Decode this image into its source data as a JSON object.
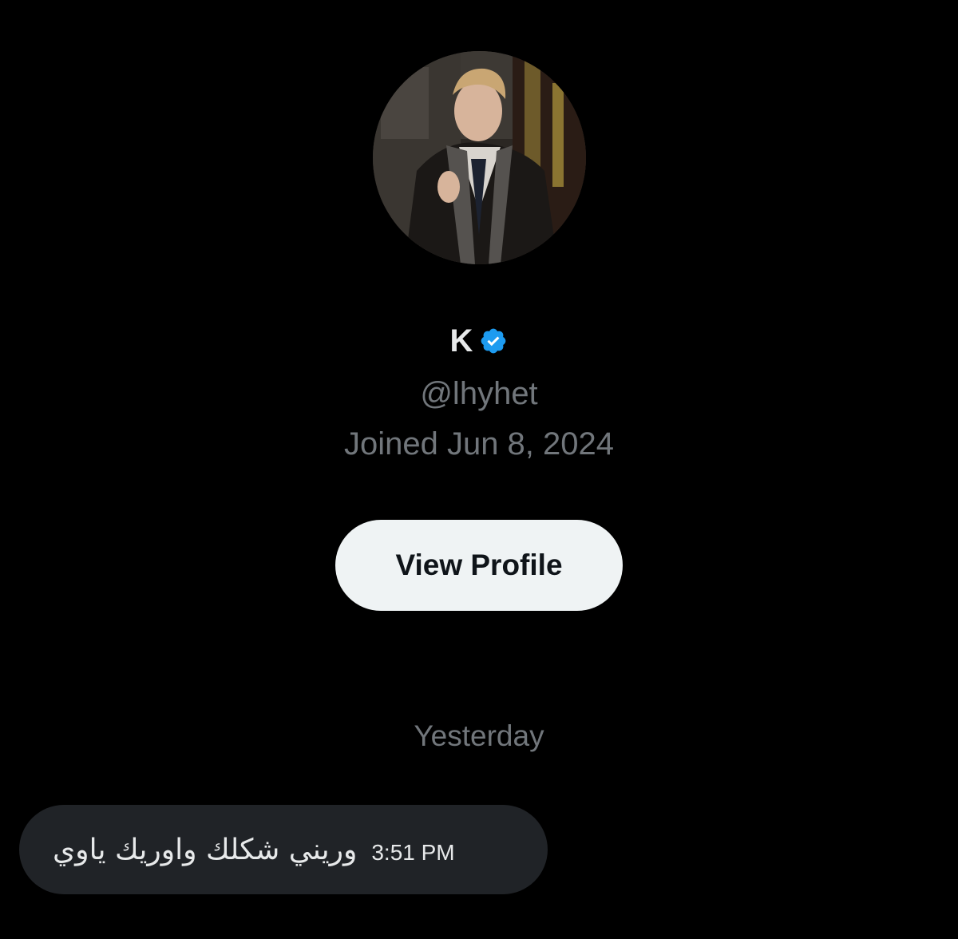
{
  "profile": {
    "display_name": "K",
    "verified": true,
    "handle": "@lhyhet",
    "joined": "Joined Jun 8, 2024",
    "view_profile_label": "View Profile"
  },
  "conversation": {
    "date_separator": "Yesterday",
    "messages": [
      {
        "text": "وريني شكلك واوريك ياوي",
        "time": "3:51 PM",
        "direction": "incoming"
      }
    ]
  },
  "icons": {
    "verified": "verified-badge-icon",
    "avatar": "profile-avatar"
  },
  "colors": {
    "background": "#000000",
    "primary_text": "#e7e9ea",
    "secondary_text": "#71767b",
    "button_bg": "#eff3f4",
    "button_text": "#0f1419",
    "bubble_bg": "#202327",
    "verified_blue": "#1d9bf0"
  }
}
